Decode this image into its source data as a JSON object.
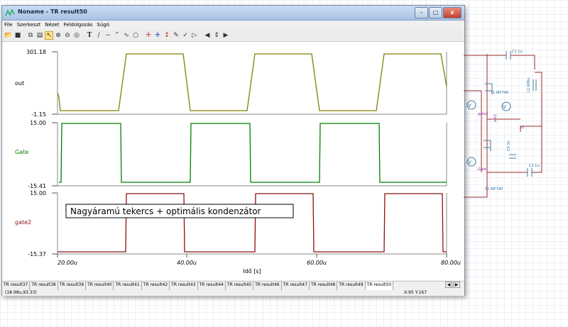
{
  "window": {
    "title": "Noname - TR result50",
    "buttons": {
      "minimize": "–",
      "maximize": "□",
      "close": "x"
    }
  },
  "menu": [
    "File",
    "Szerkeszt",
    "Nézet",
    "Feldolgozás",
    "Súgó"
  ],
  "toolbar": {
    "icons": [
      "open-icon",
      "save-icon",
      "copy-icon",
      "paste-icon",
      "pointer-icon",
      "zoom-in-icon",
      "zoom-out-icon",
      "zoom-fit-icon",
      "text-icon",
      "line-icon",
      "curve-icon",
      "step-icon",
      "sine-icon",
      "circle-icon",
      "cross-icon",
      "cursor-icon",
      "marker-icon",
      "pen-icon",
      "probe-icon",
      "arrow-icon",
      "nav-left-icon",
      "nav-updown-icon",
      "nav-right-icon"
    ]
  },
  "plot": {
    "panes": [
      {
        "label": "out",
        "ymax": "301.18",
        "ymin": "-1.15",
        "color": "#808000"
      },
      {
        "label": "Gate",
        "ymax": "15.00",
        "ymin": "-15.41",
        "color": "#008000"
      },
      {
        "label": "gate2",
        "ymax": "15.00",
        "ymin": "-15.37",
        "color": "#8b1010"
      }
    ],
    "x_ticks": [
      "20.00u",
      "40.00u",
      "60.00u",
      "80.00u"
    ],
    "xlabel": "Idő [s]",
    "annotation": "Nagyáramú tekercs + optimális kondenzátor"
  },
  "tabs": [
    "TR result37",
    "TR result38",
    "TR result39",
    "TR result40",
    "TR result41",
    "TR result42",
    "TR result43",
    "TR result44",
    "TR result45",
    "TR result46",
    "TR result47",
    "TR result48",
    "TR result49",
    "TR result50"
  ],
  "active_tab": "TR result50",
  "status": {
    "cursor": "(18.98u,93.33)",
    "xy": "X:95  Y:167"
  },
  "schematic": {
    "labels": {
      "c1": "C1 1u",
      "t1": "T1 IRF740",
      "l1": "L1 600u",
      "gate2": "gate2",
      "out": "out1",
      "x1": "x1",
      "c4": "C4 3n",
      "gate": "Gate",
      "c2": "C2 1u",
      "t2": "T2 IRF740"
    }
  }
}
